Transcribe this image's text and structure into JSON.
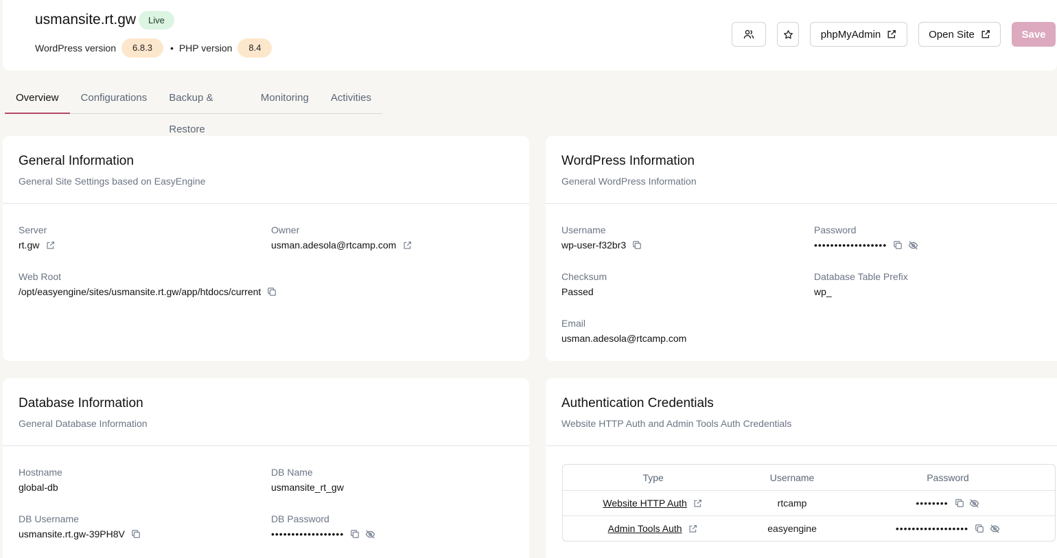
{
  "site": {
    "title": "usmansite.rt.gw",
    "status": "Live",
    "wp_label": "WordPress version",
    "wp_version": "6.8.3",
    "separator": "•",
    "php_label": "PHP version",
    "php_version": "8.4"
  },
  "header_actions": {
    "users_icon": "users-icon",
    "star_icon": "star-icon",
    "phpmyadmin_label": "phpMyAdmin",
    "open_site_label": "Open Site",
    "save_label": "Save"
  },
  "tabs": [
    {
      "label": "Overview",
      "active": true
    },
    {
      "label": "Configurations",
      "active": false
    },
    {
      "label": "Backup & Restore",
      "active": false
    },
    {
      "label": "Monitoring",
      "active": false
    },
    {
      "label": "Activities",
      "active": false
    }
  ],
  "general": {
    "title": "General Information",
    "subtitle": "General Site Settings based on EasyEngine",
    "server_label": "Server",
    "server_value": "rt.gw",
    "owner_label": "Owner",
    "owner_value": "usman.adesola@rtcamp.com",
    "webroot_label": "Web Root",
    "webroot_value": "/opt/easyengine/sites/usmansite.rt.gw/app/htdocs/current"
  },
  "wordpress": {
    "title": "WordPress Information",
    "subtitle": "General WordPress Information",
    "username_label": "Username",
    "username_value": "wp-user-f32br3",
    "password_label": "Password",
    "password_value": "••••••••••••••••••",
    "checksum_label": "Checksum",
    "checksum_value": "Passed",
    "prefix_label": "Database Table Prefix",
    "prefix_value": "wp_",
    "email_label": "Email",
    "email_value": "usman.adesola@rtcamp.com"
  },
  "database": {
    "title": "Database Information",
    "subtitle": "General Database Information",
    "hostname_label": "Hostname",
    "hostname_value": "global-db",
    "dbname_label": "DB Name",
    "dbname_value": "usmansite_rt_gw",
    "dbuser_label": "DB Username",
    "dbuser_value": "usmansite.rt.gw-39PH8V",
    "dbpass_label": "DB Password",
    "dbpass_value": "••••••••••••••••••"
  },
  "auth": {
    "title": "Authentication Credentials",
    "subtitle": "Website HTTP Auth and Admin Tools Auth Credentials",
    "col_type": "Type",
    "col_username": "Username",
    "col_password": "Password",
    "rows": [
      {
        "type": "Website HTTP Auth",
        "username": "rtcamp",
        "password": "••••••••"
      },
      {
        "type": "Admin Tools Auth",
        "username": "easyengine",
        "password": "••••••••••••••••••"
      }
    ]
  },
  "colors": {
    "accent": "#b5476b",
    "save_bg": "#dca9be",
    "live_bg": "#dcf4e2",
    "version_bg": "#fde7cc",
    "page_bg": "#f7f6f2"
  }
}
